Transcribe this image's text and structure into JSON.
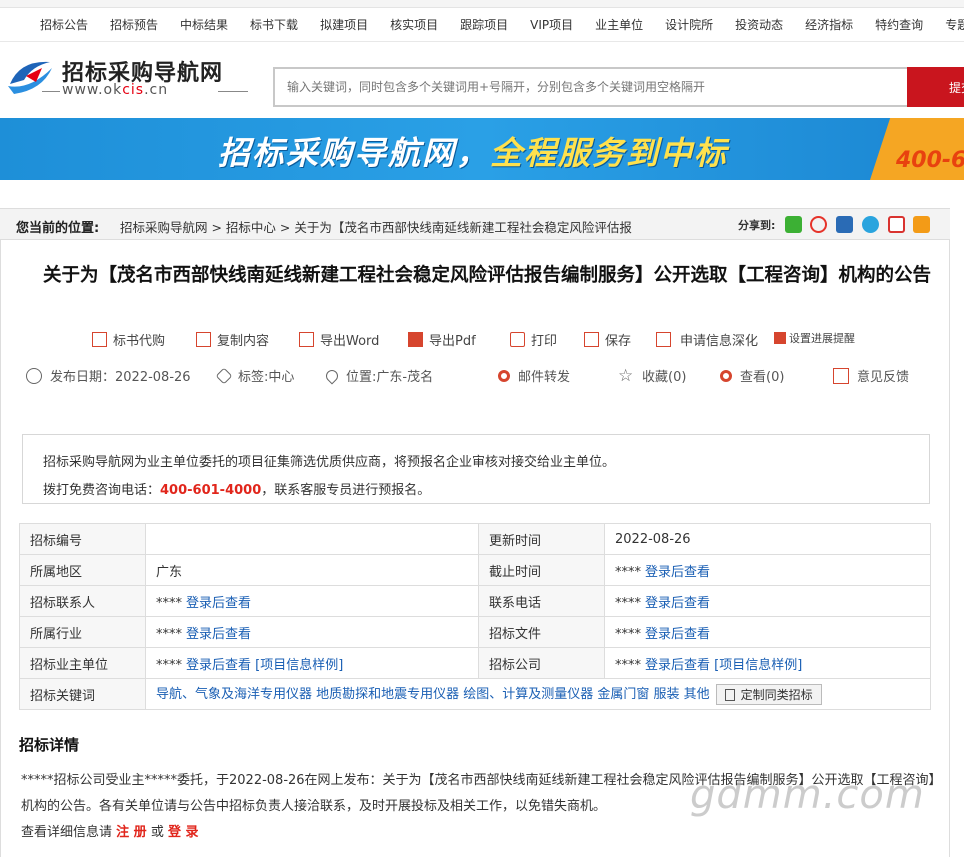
{
  "topnav": [
    "招标公告",
    "招标预告",
    "中标结果",
    "标书下载",
    "拟建项目",
    "核实项目",
    "跟踪项目",
    "VIP项目",
    "业主单位",
    "设计院所",
    "投资动态",
    "经济指标",
    "特约查询",
    "专题收"
  ],
  "logo": {
    "title": "招标采购导航网",
    "url_pre": "www.ok",
    "url_hl": "cis",
    "url_post": ".cn"
  },
  "search": {
    "placeholder": "输入关键词，同时包含多个关键词用+号隔开，分别包含多个关键词用空格隔开",
    "button": "提交"
  },
  "banner": {
    "text_white": "招标采购导航网，",
    "text_yellow": "全程服务到中标",
    "phone": "400-6"
  },
  "breadcrumb": {
    "label": "您当前的位置:",
    "path": "招标采购导航网 > 招标中心 > 关于为【茂名市西部快线南延线新建工程社会稳定风险评估报",
    "share_label": "分享到:"
  },
  "share_colors": [
    "#3cb034",
    "#e6332a",
    "#2a6bb5",
    "#2aa4de",
    "#d9332f",
    "#f39b17"
  ],
  "title": "关于为【茂名市西部快线南延线新建工程社会稳定风险评估报告编制服务】公开选取【工程咨询】机构的公告",
  "tools": [
    "标书代购",
    "复制内容",
    "导出Word",
    "导出Pdf",
    "打印",
    "保存",
    "申请信息深化",
    "设置进展提醒"
  ],
  "meta": {
    "date": "发布日期：2022-08-26",
    "tag": "标签:中心",
    "location": "位置:广东-茂名",
    "email": "邮件转发",
    "favorite": "收藏(0)",
    "views": "查看(0)",
    "feedback": "意见反馈"
  },
  "notice": {
    "line1": "招标采购导航网为业主单位委托的项目征集筛选优质供应商，将预报名企业审核对接交给业主单位。",
    "line2_pre": "拨打免费咨询电话：",
    "phone": "400-601-4000",
    "line2_post": "，联系客服专员进行预报名。"
  },
  "table": {
    "row1": {
      "k1": "招标编号",
      "v1": "",
      "k2": "更新时间",
      "v2": "2022-08-26"
    },
    "row2": {
      "k1": "所属地区",
      "v1": "广东",
      "k2": "截止时间",
      "v2": "登录后查看"
    },
    "row3": {
      "k1": "招标联系人",
      "v1": "登录后查看",
      "k2": "联系电话",
      "v2": "登录后查看"
    },
    "row4": {
      "k1": "所属行业",
      "v1": "登录后查看",
      "k2": "招标文件",
      "v2": "登录后查看"
    },
    "row5": {
      "k1": "招标业主单位",
      "v1": "登录后查看",
      "v1_extra": "[项目信息样例]",
      "k2": "招标公司",
      "v2": "登录后查看",
      "v2_extra": "[项目信息样例]"
    },
    "row6": {
      "k1": "招标关键词",
      "keywords": "导航、气象及海洋专用仪器 地质勘探和地震专用仪器 绘图、计算及测量仪器 金属门窗 服装 其他",
      "button": "定制同类招标"
    },
    "stars": "****"
  },
  "detail": {
    "section_title": "招标详情",
    "para1": "*****招标公司受业主*****委托，于2022-08-26在网上发布：关于为【茂名市西部快线南延线新建工程社会稳定风险评估报告编制服务】公开选取【工程咨询】机构的公告。各有关单位请与公告中招标负责人接洽联系，及时开展投标及相关工作，以免错失商机。",
    "para2_pre": "查看详细信息请",
    "register": "注 册",
    "or": "或",
    "login": "登 录"
  },
  "watermark": "gdmm.com"
}
